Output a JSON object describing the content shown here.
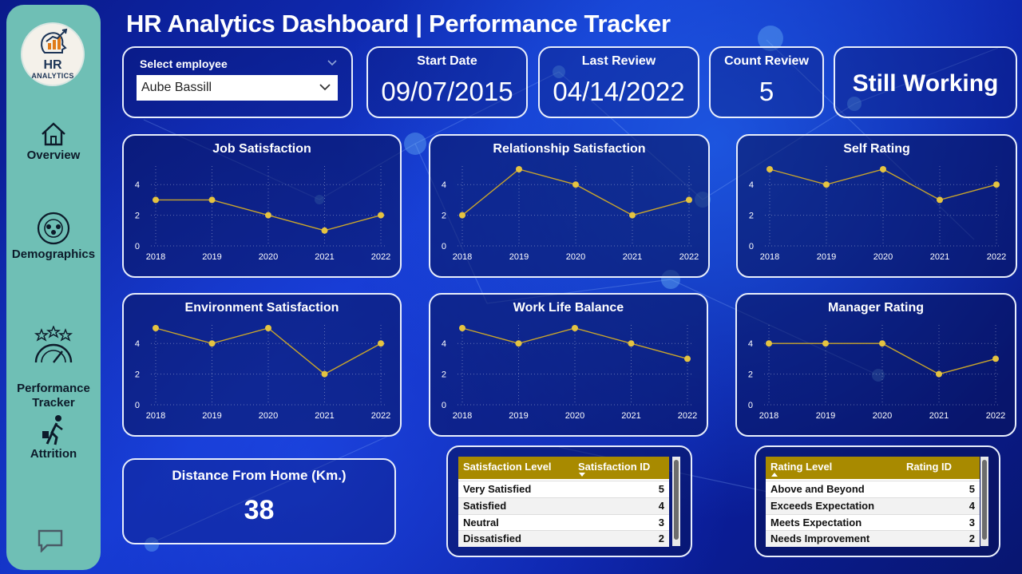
{
  "title": "HR Analytics Dashboard | Performance Tracker",
  "logo": {
    "main": "HR",
    "sub": "ANALYTICS"
  },
  "nav": [
    {
      "label": "Overview"
    },
    {
      "label": "Demographics"
    },
    {
      "label": "Performance\nTracker"
    },
    {
      "label": "Attrition"
    }
  ],
  "select": {
    "label": "Select employee",
    "value": "Aube Bassill"
  },
  "kpis": {
    "start_date": {
      "label": "Start Date",
      "value": "09/07/2015"
    },
    "last_review": {
      "label": "Last Review",
      "value": "04/14/2022"
    },
    "count_review": {
      "label": "Count Review",
      "value": "5"
    },
    "status": "Still Working"
  },
  "distance": {
    "label": "Distance From Home (Km.)",
    "value": "38"
  },
  "colors": {
    "line": "#c9a52c",
    "point": "#e5c341",
    "gold_header": "#a88a00",
    "teal": "#6fbfb5"
  },
  "chart_data": [
    {
      "type": "line",
      "title": "Job Satisfaction",
      "x": [
        "2018",
        "2019",
        "2020",
        "2021",
        "2022"
      ],
      "values": [
        3,
        3,
        2,
        1,
        2
      ],
      "yticks": [
        "0",
        "2",
        "4"
      ],
      "ylim": [
        0,
        5
      ]
    },
    {
      "type": "line",
      "title": "Relationship Satisfaction",
      "x": [
        "2018",
        "2019",
        "2020",
        "2021",
        "2022"
      ],
      "values": [
        2,
        5,
        4,
        2,
        3
      ],
      "yticks": [
        "0",
        "2",
        "4"
      ],
      "ylim": [
        0,
        5
      ]
    },
    {
      "type": "line",
      "title": "Self Rating",
      "x": [
        "2018",
        "2019",
        "2020",
        "2021",
        "2022"
      ],
      "values": [
        5,
        4,
        5,
        3,
        4
      ],
      "yticks": [
        "0",
        "2",
        "4"
      ],
      "ylim": [
        0,
        5
      ]
    },
    {
      "type": "line",
      "title": "Environment Satisfaction",
      "x": [
        "2018",
        "2019",
        "2020",
        "2021",
        "2022"
      ],
      "values": [
        5,
        4,
        5,
        2,
        4
      ],
      "yticks": [
        "0",
        "2",
        "4"
      ],
      "ylim": [
        0,
        5
      ]
    },
    {
      "type": "line",
      "title": "Work Life Balance",
      "x": [
        "2018",
        "2019",
        "2020",
        "2021",
        "2022"
      ],
      "values": [
        5,
        4,
        5,
        4,
        3
      ],
      "yticks": [
        "0",
        "2",
        "4"
      ],
      "ylim": [
        0,
        5
      ]
    },
    {
      "type": "line",
      "title": "Manager Rating",
      "x": [
        "2018",
        "2019",
        "2020",
        "2021",
        "2022"
      ],
      "values": [
        4,
        4,
        4,
        2,
        3
      ],
      "yticks": [
        "0",
        "2",
        "4"
      ],
      "ylim": [
        0,
        5
      ]
    }
  ],
  "satisfaction_table": {
    "headers": [
      "Satisfaction Level",
      "Satisfaction ID"
    ],
    "rows": [
      [
        "Very Satisfied",
        "5"
      ],
      [
        "Satisfied",
        "4"
      ],
      [
        "Neutral",
        "3"
      ],
      [
        "Dissatisfied",
        "2"
      ]
    ]
  },
  "rating_table": {
    "headers": [
      "Rating Level",
      "Rating ID"
    ],
    "rows": [
      [
        "Above and Beyond",
        "5"
      ],
      [
        "Exceeds Expectation",
        "4"
      ],
      [
        "Meets Expectation",
        "3"
      ],
      [
        "Needs Improvement",
        "2"
      ]
    ]
  }
}
